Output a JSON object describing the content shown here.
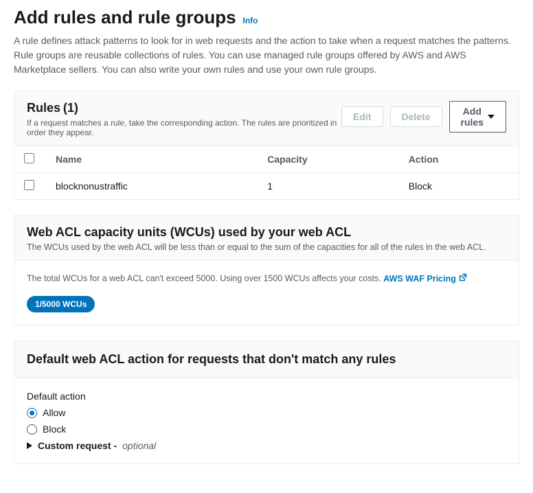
{
  "header": {
    "title": "Add rules and rule groups",
    "info": "Info",
    "description": "A rule defines attack patterns to look for in web requests and the action to take when a request matches the patterns. Rule groups are reusable collections of rules. You can use managed rule groups offered by AWS and AWS Marketplace sellers. You can also write your own rules and use your own rule groups."
  },
  "rulesPanel": {
    "title": "Rules",
    "count": "(1)",
    "subtitle": "If a request matches a rule, take the corresponding action. The rules are prioritized in order they appear.",
    "buttons": {
      "edit": "Edit",
      "delete": "Delete",
      "add": "Add rules"
    },
    "columns": {
      "name": "Name",
      "capacity": "Capacity",
      "action": "Action"
    },
    "rows": [
      {
        "name": "blocknonustraffic",
        "capacity": "1",
        "action": "Block"
      }
    ]
  },
  "wcuPanel": {
    "title": "Web ACL capacity units (WCUs) used by your web ACL",
    "desc": "The WCUs used by the web ACL will be less than or equal to the sum of the capacities for all of the rules in the web ACL.",
    "note": "The total WCUs for a web ACL can't exceed 5000. Using over 1500 WCUs affects your costs. ",
    "linkText": "AWS WAF Pricing",
    "pill": "1/5000 WCUs"
  },
  "defaultAction": {
    "title": "Default web ACL action for requests that don't match any rules",
    "label": "Default action",
    "allow": "Allow",
    "block": "Block",
    "customRequest": "Custom request -",
    "optional": "optional"
  }
}
